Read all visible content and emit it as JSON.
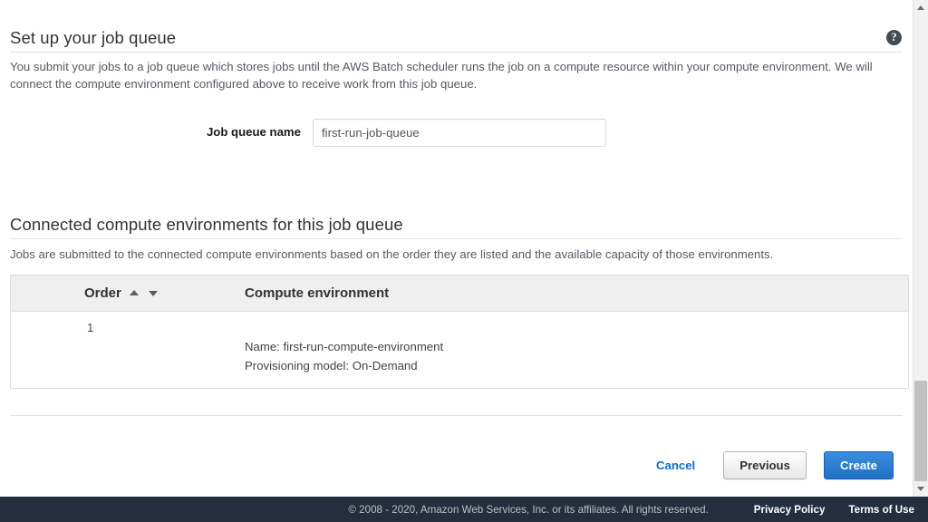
{
  "section_job_queue": {
    "heading": "Set up your job queue",
    "description": "You submit your jobs to a job queue which stores jobs until the AWS Batch scheduler runs the job on a compute resource within your compute environment. We will connect the compute environment configured above to receive work from this job queue.",
    "help_icon": "help-circle-icon",
    "field": {
      "label": "Job queue name",
      "value": "first-run-job-queue",
      "placeholder": ""
    }
  },
  "section_compute_environments": {
    "heading": "Connected compute environments for this job queue",
    "description": "Jobs are submitted to the connected compute environments based on the order they are listed and the available capacity of those environments.",
    "table": {
      "columns": [
        "Order",
        "Compute environment"
      ],
      "sort_controls": {
        "up": "sort-ascending-icon",
        "down": "sort-descending-icon"
      },
      "rows": [
        {
          "order": "1",
          "name_line": "Name: first-run-compute-environment",
          "provisioning_line": "Provisioning model: On-Demand"
        }
      ]
    }
  },
  "actions": {
    "cancel_label": "Cancel",
    "previous_label": "Previous",
    "create_label": "Create"
  },
  "footer": {
    "copyright": "© 2008 - 2020, Amazon Web Services, Inc. or its affiliates. All rights reserved.",
    "privacy_label": "Privacy Policy",
    "terms_label": "Terms of Use"
  },
  "colors": {
    "accent_blue": "#1f6fc4",
    "link_blue": "#0a6dc2",
    "footer_bg": "#232f3e",
    "table_header_bg": "#efefef"
  }
}
